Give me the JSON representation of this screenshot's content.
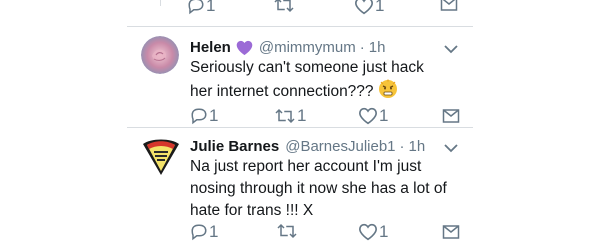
{
  "prev_actions": {
    "reply_count": "1",
    "like_count": "1"
  },
  "tweets": [
    {
      "name": "Helen",
      "handle": "@mimmymum",
      "separator": "·",
      "time": "1h",
      "text": "Seriously can't someone just hack her internet connection???",
      "emoji": "angry-face-emoji",
      "badge": "purple-heart-emoji",
      "actions": {
        "reply_count": "1",
        "retweet_count": "1",
        "like_count": "1"
      }
    },
    {
      "name": "Julie Barnes",
      "handle": "@BarnesJulieb1",
      "separator": "·",
      "time": "1h",
      "text": "Na just report her account I'm just nosing through it now she has a lot of hate for trans !!! X",
      "avatar_logo_text": "",
      "actions": {
        "reply_count": "1",
        "like_count": "1"
      }
    }
  ],
  "colors": {
    "icon_gray": "#657786",
    "divider": "#d9dde1",
    "heart_purple": "#9b6ad6",
    "text": "#14171a"
  }
}
